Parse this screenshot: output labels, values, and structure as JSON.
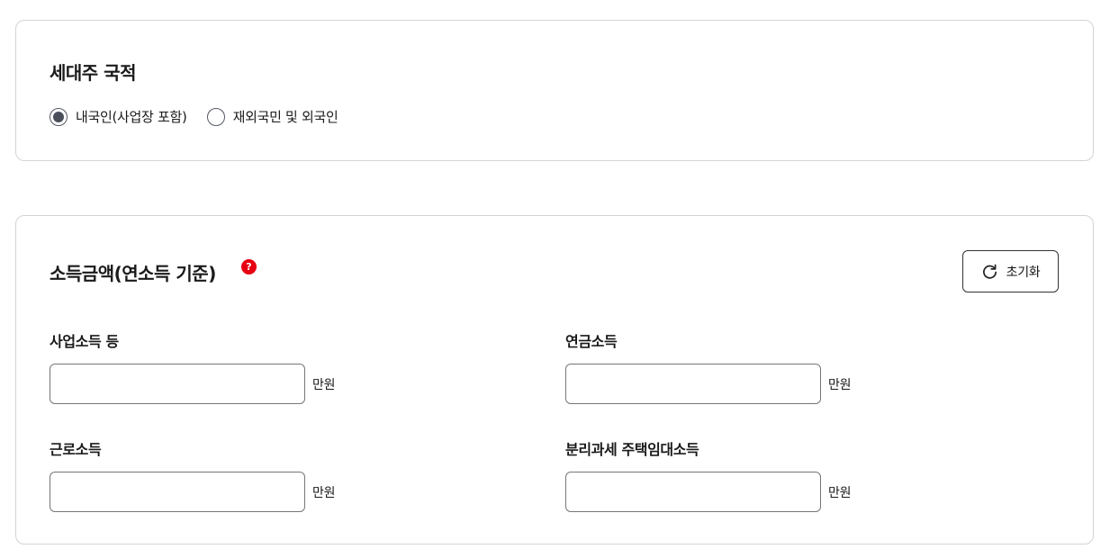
{
  "nationality": {
    "title": "세대주 국적",
    "options": [
      {
        "label": "내국인(사업장 포함)",
        "selected": true
      },
      {
        "label": "재외국민 및 외국인",
        "selected": false
      }
    ]
  },
  "income": {
    "title": "소득금액(연소득 기준)",
    "help_icon": "question-icon",
    "help_symbol": "?",
    "reset_label": "초기화",
    "reset_icon": "refresh-icon",
    "accent_color": "#e60012",
    "fields": [
      {
        "label": "사업소득 등",
        "value": "",
        "unit": "만원"
      },
      {
        "label": "연금소득",
        "value": "",
        "unit": "만원"
      },
      {
        "label": "근로소득",
        "value": "",
        "unit": "만원"
      },
      {
        "label": "분리과세 주택임대소득",
        "value": "",
        "unit": "만원"
      }
    ]
  }
}
